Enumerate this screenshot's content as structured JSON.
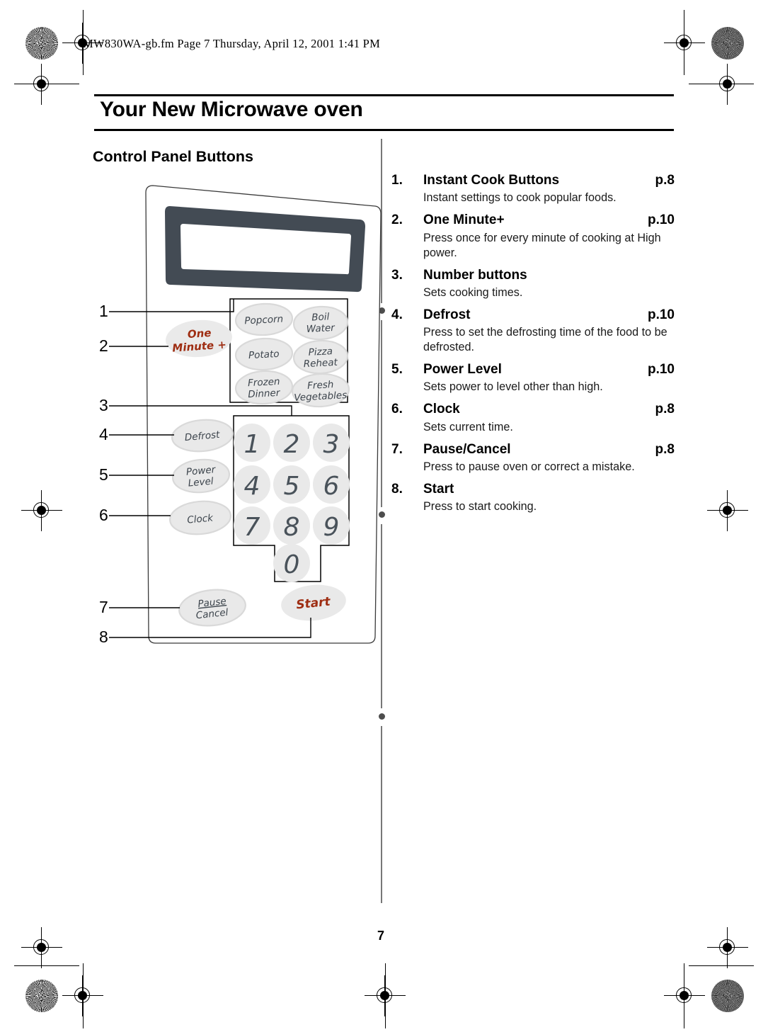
{
  "meta": {
    "filename_line": "MW830WA-gb.fm  Page 7  Thursday, April 12, 2001  1:41 PM",
    "page_number": "7"
  },
  "chapter": {
    "title": "Your New Microwave oven",
    "section_title": "Control Panel Buttons"
  },
  "control_panel": {
    "callout_numbers": [
      "1",
      "2",
      "3",
      "4",
      "5",
      "6",
      "7",
      "8"
    ],
    "one_minute_button": "One\nMinute +",
    "one_minute_line1": "One",
    "one_minute_line2": "Minute +",
    "instant_cook_buttons": [
      {
        "line1": "Popcorn",
        "line2": ""
      },
      {
        "line1": "Boil",
        "line2": "Water"
      },
      {
        "line1": "Potato",
        "line2": ""
      },
      {
        "line1": "Pizza",
        "line2": "Reheat"
      },
      {
        "line1": "Frozen",
        "line2": "Dinner"
      },
      {
        "line1": "Fresh",
        "line2": "Vegetables"
      }
    ],
    "function_buttons": [
      {
        "line1": "Defrost",
        "line2": ""
      },
      {
        "line1": "Power",
        "line2": "Level"
      },
      {
        "line1": "Clock",
        "line2": ""
      }
    ],
    "number_buttons": [
      "1",
      "2",
      "3",
      "4",
      "5",
      "6",
      "7",
      "8",
      "9",
      "0"
    ],
    "pause_cancel_line1": "Pause",
    "pause_cancel_line2": "Cancel",
    "start_button": "Start",
    "colors": {
      "accent_red": "#9e2d12",
      "display_frame": "#434b54",
      "button_fill": "#e9e9e9",
      "button_stroke": "#d8d8d8",
      "key_text": "#4a535b"
    }
  },
  "button_list": [
    {
      "num": "1.",
      "label": "Instant Cook Buttons",
      "page": "p.8",
      "desc": "Instant settings to cook popular foods."
    },
    {
      "num": "2.",
      "label": "One Minute+",
      "page": "p.10",
      "desc": "Press once for every minute of cooking at High power."
    },
    {
      "num": "3.",
      "label": "Number buttons",
      "page": "",
      "desc": "Sets cooking times."
    },
    {
      "num": "4.",
      "label": "Defrost",
      "page": "p.10",
      "desc": "Press to set the defrosting time of the food to be defrosted."
    },
    {
      "num": "5.",
      "label": "Power Level",
      "page": "p.10",
      "desc": "Sets power to level other than high."
    },
    {
      "num": "6.",
      "label": "Clock",
      "page": "p.8",
      "desc": "Sets current time."
    },
    {
      "num": "7.",
      "label": "Pause/Cancel",
      "page": "p.8",
      "desc": "Press to pause oven or correct a mistake."
    },
    {
      "num": "8.",
      "label": "Start",
      "page": "",
      "desc": "Press to start cooking."
    }
  ]
}
